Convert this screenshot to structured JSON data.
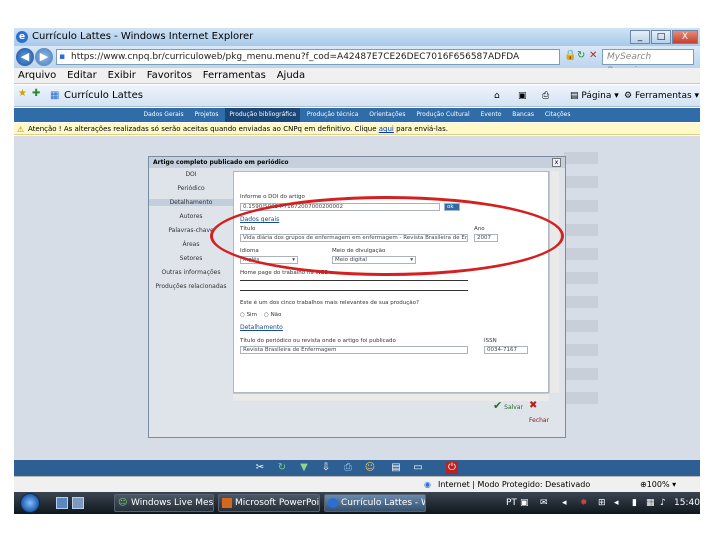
{
  "window": {
    "title": "Currículo Lattes - Windows Internet Explorer",
    "min": "_",
    "max": "□",
    "close": "X"
  },
  "address": {
    "url": "https://www.cnpq.br/curriculoweb/pkg_menu.menu?f_cod=A42487E7CE26DEC7016F656587ADFDA",
    "search_placeholder": "MySearch Pesquisar"
  },
  "menu": {
    "items": [
      "Arquivo",
      "Editar",
      "Exibir",
      "Favoritos",
      "Ferramentas",
      "Ajuda"
    ]
  },
  "tab": {
    "title": "Currículo Lattes"
  },
  "commandbar": {
    "page": "Página",
    "tools": "Ferramentas"
  },
  "sitenav": {
    "items": [
      "Dados Gerais",
      "Projetos",
      "Produção bibliográfica",
      "Produção técnica",
      "Orientações",
      "Produção Cultural",
      "Evento",
      "Bancas",
      "Citações"
    ],
    "active_index": 2
  },
  "warning": {
    "text_before": "Atenção ! As alterações realizadas só serão aceitas quando enviadas ao CNPq em definitivo. Clique ",
    "link": "aqui",
    "text_after": " para enviá-las."
  },
  "modal": {
    "title": "Artigo completo publicado em periódico",
    "close": "x",
    "left_nav": [
      "DOI",
      "Periódico",
      "Detalhamento",
      "Autores",
      "Palavras-chave",
      "Áreas",
      "Setores",
      "Outras informações",
      "Produções relacionadas"
    ],
    "left_nav_selected": 2,
    "form": {
      "doi_label": "Informe o DOI do artigo",
      "doi_value": "0.1590/S0034-71672007000200002",
      "doi_button": "ok",
      "dados_gerais": "Dados gerais",
      "titulo_label": "Título",
      "titulo_value": "Vida diária dos grupos de enfermagem em enfermagem - Revista Brasileira de Enfermagem",
      "ano_label": "Ano",
      "ano_value": "2007",
      "idioma_label": "Idioma",
      "idioma_value": "Inglês",
      "meio_label": "Meio de divulgação",
      "meio_value": "Meio digital",
      "homepage_label": "Home page do trabalho na WEB",
      "relevante_label": "Este é um dos cinco trabalhos mais relevantes de sua produção?",
      "radio_sim": "Sim",
      "radio_nao": "Não",
      "detalhamento": "Detalhamento",
      "periodico_label": "Título do periódico ou revista onde o artigo foi publicado",
      "periodico_value": "Revista Brasileira de Enfermagem",
      "issn_label": "ISSN",
      "issn_value": "0034-7167"
    },
    "ok_button": "Salvar",
    "cancel_button": "Fechar"
  },
  "statusbar": {
    "zone": "Internet | Modo Protegido: Desativado",
    "zoom": "100%"
  },
  "taskbar": {
    "buttons": [
      "Windows Live Messe...",
      "Microsoft PowerPoin...",
      "Currículo Lattes - Wi..."
    ],
    "lang": "PT",
    "clock": "15:40"
  },
  "colors": {
    "highlight": "#d42020",
    "accent": "#2f6ca8"
  }
}
